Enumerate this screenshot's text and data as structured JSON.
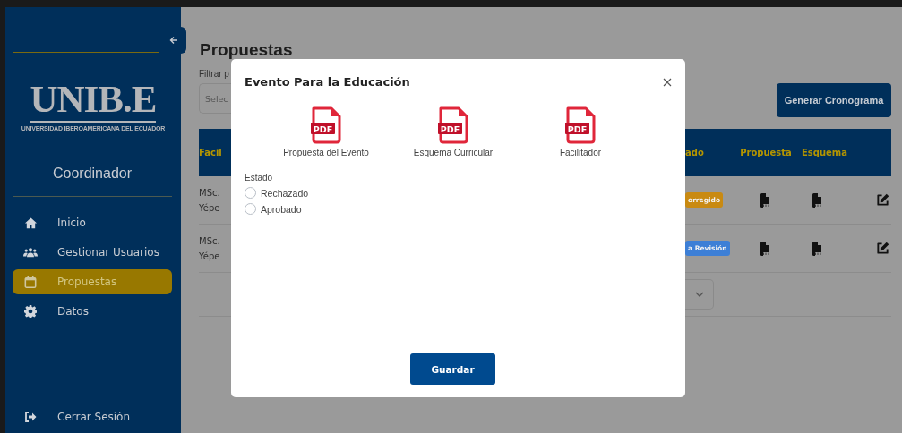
{
  "sidebar": {
    "logo": {
      "title": "UNIB.E",
      "subtitle": "UNIVERSIDAD IBEROAMERICANA DEL ECUADOR"
    },
    "role": "Coordinador",
    "menu": [
      {
        "label": "Inicio",
        "selected": false
      },
      {
        "label": "Gestionar Usuarios",
        "selected": false
      },
      {
        "label": "Propuestas",
        "selected": true
      },
      {
        "label": "Datos",
        "selected": false
      }
    ],
    "logout": "Cerrar Sesión"
  },
  "page": {
    "title": "Propuestas",
    "filter_label": "Filtrar p",
    "filter_placeholder": "Selec",
    "schedule_button": "Generar Cronograma",
    "table": {
      "columns": [
        "Facil",
        "ado",
        "Propuesta",
        "Esquema"
      ],
      "rows": [
        {
          "facilitator": [
            "MSc.",
            "Yépe"
          ],
          "status": "orregido",
          "color": "#c98a12"
        },
        {
          "facilitator": [
            "MSc.",
            "Yépe"
          ],
          "status": "a Revisión",
          "color": "#3d7fd6"
        }
      ]
    }
  },
  "modal": {
    "title": "Evento Para la Educación",
    "files": [
      {
        "icon_text": "PDF",
        "label": "Propuesta del Evento"
      },
      {
        "icon_text": "PDF",
        "label": "Esquema Curricular"
      },
      {
        "icon_text": "PDF",
        "label": "Facilitador"
      }
    ],
    "status_label": "Estado",
    "options": [
      {
        "label": "Rechazado",
        "selected": false
      },
      {
        "label": "Aprobado",
        "selected": false
      }
    ],
    "save_button": "Guardar"
  }
}
